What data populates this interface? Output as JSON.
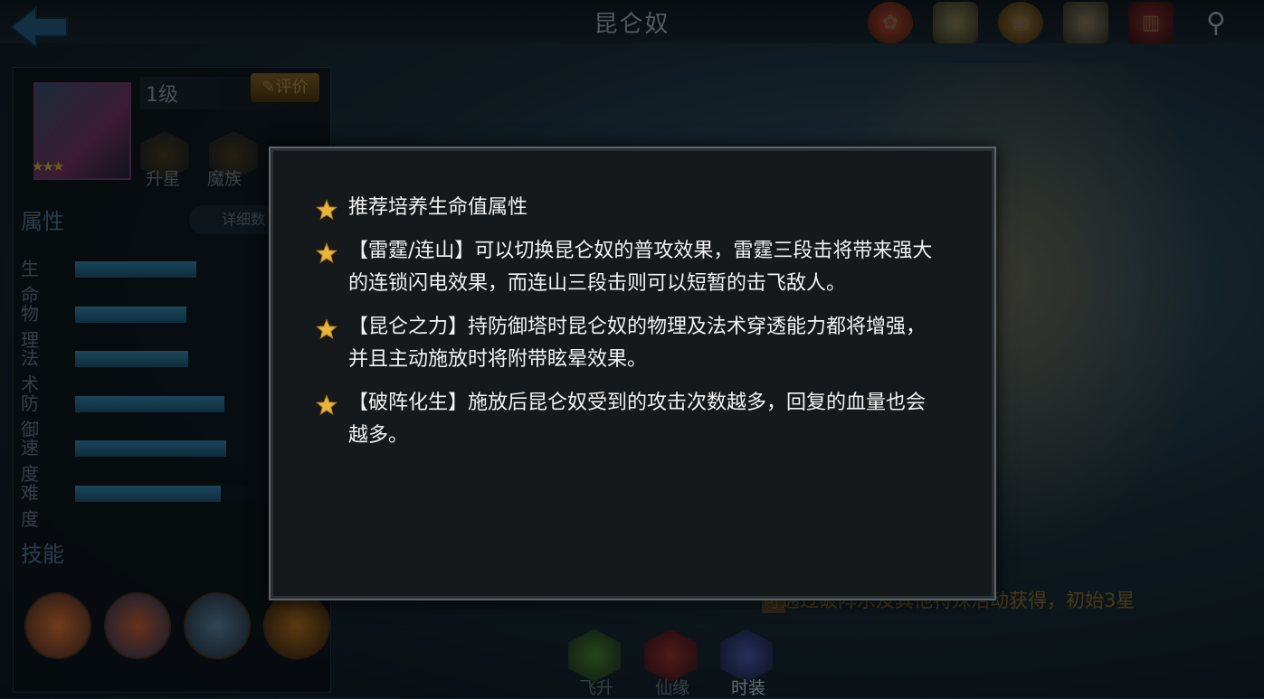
{
  "header": {
    "title": "昆仑奴",
    "icons": [
      "scroll-seal-icon",
      "map-scroll-icon",
      "coin-icon",
      "paper-icon",
      "book-icon",
      "magnifier-icon"
    ]
  },
  "hero": {
    "level": "1级",
    "rate_label": "评价",
    "star_count": 3,
    "tabs": [
      "升星",
      "魔族"
    ]
  },
  "attributes": {
    "section_title": "属性",
    "detail_label": "详细数",
    "stats": [
      {
        "label": "生命",
        "value": 0.61
      },
      {
        "label": "物理",
        "value": 0.56
      },
      {
        "label": "法术",
        "value": 0.57
      },
      {
        "label": "防御",
        "value": 0.75
      },
      {
        "label": "速度",
        "value": 0.76
      },
      {
        "label": "难度",
        "value": 0.73
      }
    ]
  },
  "skills": {
    "section_title": "技能",
    "count": 4
  },
  "source_note": "可通过破阵乐及其他特殊活动获得，初始3星",
  "bottom_tabs": [
    {
      "label": "飞升"
    },
    {
      "label": "仙缘"
    },
    {
      "label": "时装"
    }
  ],
  "modal": {
    "tips": [
      "推荐培养生命值属性",
      "【雷霆/连山】可以切换昆仑奴的普攻效果，雷霆三段击将带来强大的连锁闪电效果，而连山三段击则可以短暂的击飞敌人。",
      "【昆仑之力】持防御塔时昆仑奴的物理及法术穿透能力都将增强，并且主动施放时将附带眩晕效果。",
      "【破阵化生】施放后昆仑奴受到的攻击次数越多，回复的血量也会越多。"
    ]
  }
}
